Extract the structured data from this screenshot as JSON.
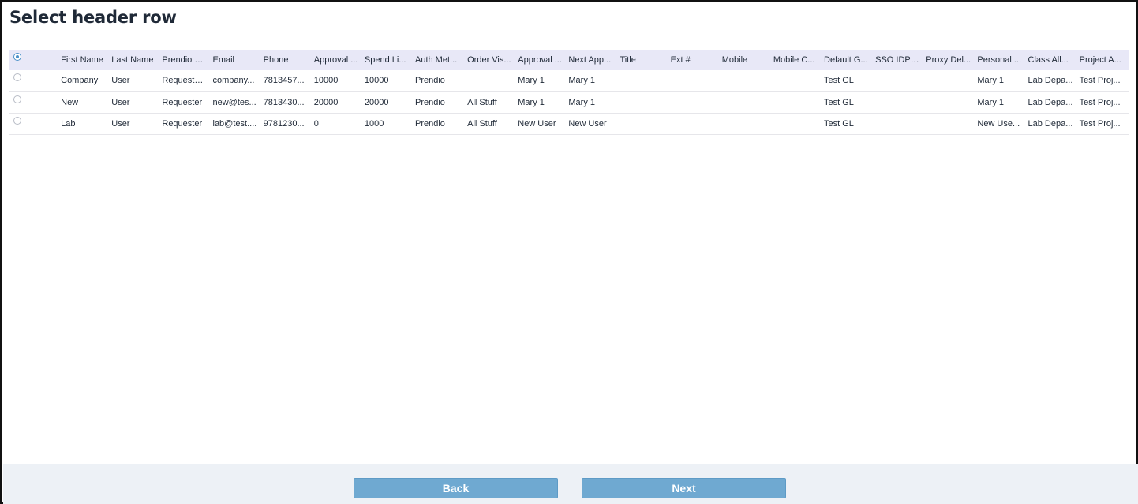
{
  "page": {
    "title": "Select header row"
  },
  "table": {
    "columns": [
      "First Name",
      "Last Name",
      "Prendio R...",
      "Email",
      "Phone",
      "Approval ...",
      "Spend Li...",
      "Auth Met...",
      "Order Vis...",
      "Approval ...",
      "Next App...",
      "Title",
      "Ext #",
      "Mobile",
      "Mobile C...",
      "Default G...",
      "SSO IDP ...",
      "Proxy Del...",
      "Personal ...",
      "Class All...",
      "Project A..."
    ],
    "header_selected": true,
    "rows": [
      [
        "Company",
        "User",
        "Requeste...",
        "company...",
        "7813457...",
        "10000",
        "10000",
        "Prendio",
        "",
        "Mary 1",
        "Mary 1",
        "",
        "",
        "",
        "",
        "Test GL",
        "",
        "",
        "Mary 1",
        "Lab Depa...",
        "Test Proj..."
      ],
      [
        "New",
        "User",
        "Requester",
        "new@tes...",
        "7813430...",
        "20000",
        "20000",
        "Prendio",
        "All Stuff",
        "Mary 1",
        "Mary 1",
        "",
        "",
        "",
        "",
        "Test GL",
        "",
        "",
        "Mary 1",
        "Lab Depa...",
        "Test Proj..."
      ],
      [
        "Lab",
        "User",
        "Requester",
        "lab@test....",
        "9781230...",
        "0",
        "1000",
        "Prendio",
        "All Stuff",
        "New User",
        "New User",
        "",
        "",
        "",
        "",
        "Test GL",
        "",
        "",
        "New Use...",
        "Lab Depa...",
        "Test Proj..."
      ]
    ]
  },
  "footer": {
    "back_label": "Back",
    "next_label": "Next"
  },
  "colors": {
    "accent": "#6fa9d1",
    "header_bg": "#e8e8f7",
    "footer_bg": "#edf1f6"
  }
}
